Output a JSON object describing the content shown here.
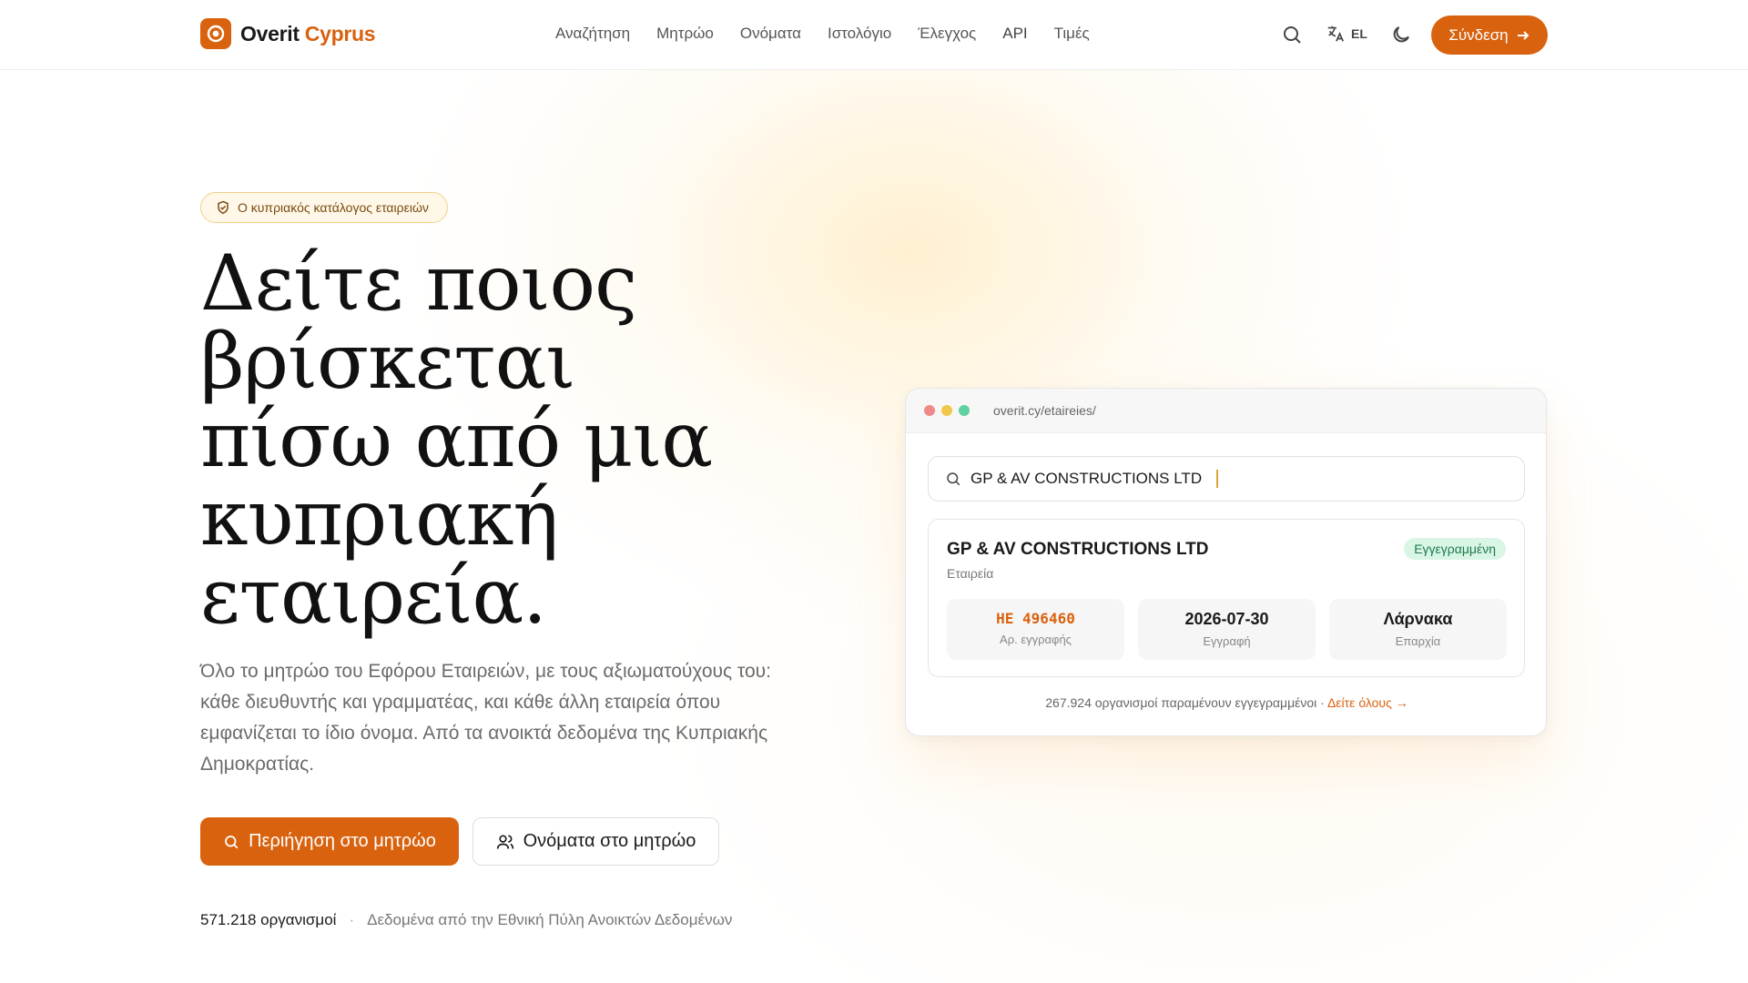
{
  "header": {
    "brand_part1": "Overit",
    "brand_part2": "Cyprus",
    "nav": [
      "Αναζήτηση",
      "Μητρώο",
      "Ονόματα",
      "Ιστολόγιο",
      "Έλεγχος",
      "API",
      "Τιμές"
    ],
    "lang": "EL",
    "signin_label": "Σύνδεση"
  },
  "hero": {
    "badge": "Ο κυπριακός κατάλογος εταιρειών",
    "headline": [
      "Δείτε ποιος",
      "βρίσκεται",
      "πίσω από μια",
      "κυπριακή",
      "εταιρεία."
    ],
    "lead": "Όλο το μητρώο του Εφόρου Εταιρειών, με τους αξιωματούχους του: κάθε διευθυντής και γραμματέας, και κάθε άλλη εταιρεία όπου εμφανίζεται το ίδιο όνομα. Από τα ανοικτά δεδομένα της Κυπριακής Δημοκρατίας.",
    "primary_button": "Περιήγηση στο μητρώο",
    "secondary_button": "Ονόματα στο μητρώο",
    "stats_count": "571.218 οργανισμοί",
    "stats_sep": "·",
    "stats_source": "Δεδομένα από την Εθνική Πύλη Ανοικτών Δεδομένων"
  },
  "mock": {
    "url": "overit.cy/etaireies/",
    "search_value": "GP & AV CONSTRUCTIONS LTD",
    "card": {
      "title": "GP & AV CONSTRUCTIONS LTD",
      "subtitle": "Εταιρεία",
      "status": "Εγγεγραμμένη",
      "tiles": [
        {
          "value": "ΗΕ 496460",
          "label": "Αρ. εγγραφής"
        },
        {
          "value": "2026-07-30",
          "label": "Εγγραφή"
        },
        {
          "value": "Λάρνακα",
          "label": "Επαρχία"
        }
      ]
    },
    "footer_text": "267.924 οργανισμοί παραμένουν εγγεγραμμένοι ·",
    "footer_link": "Δείτε όλους →"
  },
  "colors": {
    "accent": "#d9620f",
    "status_bg": "#d9f5e6",
    "status_fg": "#1d7a4a"
  }
}
